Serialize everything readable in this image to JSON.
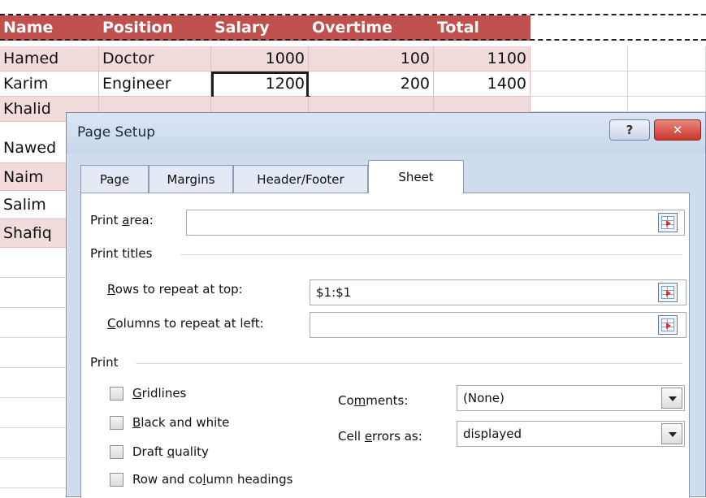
{
  "spreadsheet": {
    "header": [
      "Name",
      "Position",
      "Salary",
      "Overtime",
      "Total"
    ],
    "rows": [
      [
        "Hamed",
        "Doctor",
        "1000",
        "100",
        "1100"
      ],
      [
        "Karim",
        "Engineer",
        "1200",
        "200",
        "1400"
      ],
      [
        "Khalid",
        "",
        "",
        "",
        ""
      ],
      [
        "Nawed",
        "",
        "",
        "",
        ""
      ],
      [
        "Naim",
        "",
        "",
        "",
        ""
      ],
      [
        "Salim",
        "",
        "",
        "",
        ""
      ],
      [
        "Shafiq",
        "",
        "",
        "",
        ""
      ]
    ],
    "header_color": "#c0504d",
    "band_color": "#f2dcdb"
  },
  "dialog": {
    "title": "Page Setup",
    "help_button": "?",
    "close_button": "✕",
    "tabs": [
      {
        "label": "Page"
      },
      {
        "label": "Margins"
      },
      {
        "label": "Header/Footer"
      },
      {
        "label": "Sheet",
        "active": true
      }
    ],
    "print_area": {
      "label_pre": "Print ",
      "label_key": "a",
      "label_post": "rea:",
      "value": ""
    },
    "print_titles": {
      "section": "Print titles",
      "rows_label_key": "R",
      "rows_label_post": "ows to repeat at top:",
      "rows_value": "$1:$1",
      "cols_label_key": "C",
      "cols_label_post": "olumns to repeat at left:",
      "cols_value": ""
    },
    "print": {
      "section": "Print",
      "gridlines_key": "G",
      "gridlines_post": "ridlines",
      "bw_key": "B",
      "bw_post": "lack and white",
      "draft_pre": "Draft ",
      "draft_key": "q",
      "draft_post": "uality",
      "headings_pre": "Row and co",
      "headings_key": "l",
      "headings_post": "umn headings",
      "comments_pre": "Co",
      "comments_key": "m",
      "comments_post": "ments:",
      "comments_value": "(None)",
      "errors_pre": "Cell ",
      "errors_key": "e",
      "errors_post": "rrors as:",
      "errors_value": "displayed"
    }
  }
}
